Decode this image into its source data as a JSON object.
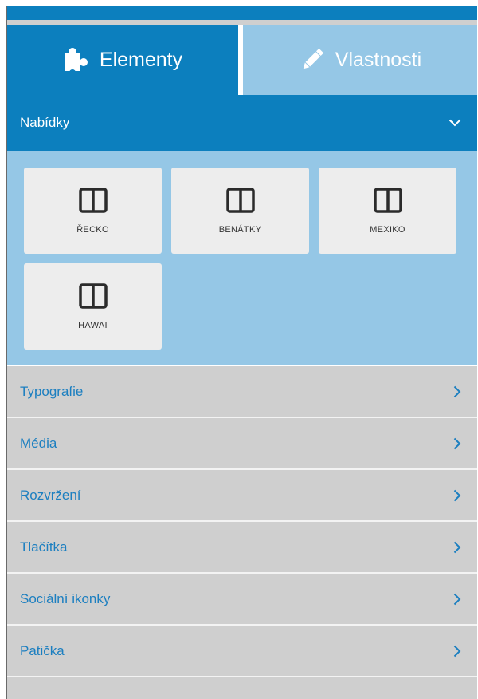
{
  "tabs": {
    "elements": {
      "label": "Elementy",
      "icon": "puzzle-icon"
    },
    "properties": {
      "label": "Vlastnosti",
      "icon": "pencil-icon"
    }
  },
  "open_category": {
    "label": "Nabídky",
    "icon": "chevron-down-icon",
    "blocks": [
      {
        "label": "ŘECKO",
        "icon": "columns-icon"
      },
      {
        "label": "BENÁTKY",
        "icon": "columns-icon"
      },
      {
        "label": "MEXIKO",
        "icon": "columns-icon"
      },
      {
        "label": "HAWAI",
        "icon": "columns-icon"
      }
    ]
  },
  "categories": [
    {
      "label": "Typografie",
      "icon": "chevron-right-icon"
    },
    {
      "label": "Média",
      "icon": "chevron-right-icon"
    },
    {
      "label": "Rozvržení",
      "icon": "chevron-right-icon"
    },
    {
      "label": "Tlačítka",
      "icon": "chevron-right-icon"
    },
    {
      "label": "Sociální ikonky",
      "icon": "chevron-right-icon"
    },
    {
      "label": "Patička",
      "icon": "chevron-right-icon"
    }
  ],
  "colors": {
    "primary": "#0c7fbe",
    "light": "#95c7e6",
    "category_bg": "#cfcfcf",
    "category_text": "#1c7fc0",
    "block_bg": "#ededed"
  }
}
